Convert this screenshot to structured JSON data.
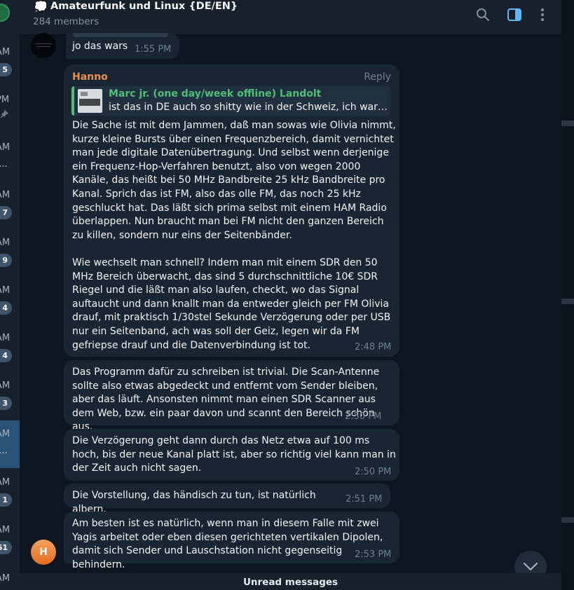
{
  "left_list": {
    "items": [
      {
        "time": "AM",
        "badge": "5"
      },
      {
        "time": "PM",
        "pinned": true
      },
      {
        "time": "AM",
        "sub": "n..."
      },
      {
        "time": "AM",
        "badge": "7"
      },
      {
        "time": "AM",
        "badge": "9"
      },
      {
        "time": "AM",
        "badge": "4"
      },
      {
        "time": "AM",
        "badge": "4"
      },
      {
        "time": "AM",
        "badge": "3"
      },
      {
        "time": "AM",
        "sub": "n...",
        "active": true
      },
      {
        "time": "AM",
        "badge": "1"
      },
      {
        "time": "AM",
        "badge": "61"
      },
      {
        "time": "AM"
      }
    ]
  },
  "header": {
    "emoji": "💭",
    "title": "Amateurfunk und Linux {DE/EN}",
    "subtitle": "284 members",
    "icons": [
      "search-icon",
      "sidebar-toggle-icon",
      "more-vertical-icon"
    ]
  },
  "messages": [
    {
      "text": "jo das wars",
      "time": "1:55 PM"
    },
    {
      "sender": "Hanno",
      "reply_label": "Reply",
      "quote": {
        "name": "Marc jr. (one day/week offline) Landolt",
        "text": "ist das in DE auch so shitty wie in der Schweiz, ich war ja K..."
      },
      "text": "Die Sache ist mit dem Jammen, daß man sowas wie Olivia nimmt, kurze kleine Bursts über einen Frequenzbereich, damit vernichtet man jede digitale Datenübertragung. Und selbst wenn derjenige ein Frequenz-Hop-Verfahren benutzt, also von wegen 2000 Kanäle, das heißt bei 50 MHz Bandbreite 25 kHz Bandbreite pro Kanal. Sprich das ist FM, also das olle FM, das noch 25 kHz geschluckt hat. Das läßt sich prima selbst mit einem HAM Radio überlappen. Nun braucht man bei FM nicht den ganzen Bereich zu killen, sondern nur eins der Seitenbänder.\n\nWie wechselt man schnell? Indem man mit einem SDR den 50 MHz Bereich überwacht, das sind 5 durchschnittliche 10€ SDR Riegel und die läßt man also laufen, checkt, wo das Signal auftaucht und dann knallt man da entweder gleich per FM Olivia drauf, mit praktisch 1/30stel Sekunde Verzögerung oder per USB nur ein Seitenband, ach was soll der Geiz, legen wir da FM gefriepse drauf und die Datenverbindung ist tot.",
      "time": "2:48 PM"
    },
    {
      "text": "Das Programm dafür zu schreiben ist trivial. Die Scan-Antenne sollte also etwas abgedeckt und entfernt vom Sender bleiben, aber das läuft. Ansonsten nimmt man einen SDR Scanner aus dem Web, bzw. ein paar davon und scannt den Bereich schön aus.",
      "time": "2:50 PM"
    },
    {
      "text": "Die Verzögerung geht dann durch das Netz etwa auf 100 ms hoch, bis der neue Kanal platt ist, aber so richtig viel kann man in der Zeit auch nicht sagen.",
      "time": "2:50 PM"
    },
    {
      "text": "Die Vorstellung, das händisch zu tun, ist natürlich albern.",
      "time": "2:51 PM"
    },
    {
      "text": "Am besten ist es natürlich, wenn man in diesem Falle mit zwei Yagis arbeitet oder eben diesen gerichteten vertikalen Dipolen, damit sich Sender und Lauschstation nicht gegenseitig behindern.",
      "time": "2:53 PM"
    }
  ],
  "sender_avatar_initial": "H",
  "unread_bar": "Unread messages",
  "colors": {
    "background": "#0e1621",
    "panel": "#17212b",
    "bubble": "#182533",
    "sender_name": "#e8904a",
    "quote_accent": "#4fbe79",
    "accent": "#5eb5f7"
  }
}
